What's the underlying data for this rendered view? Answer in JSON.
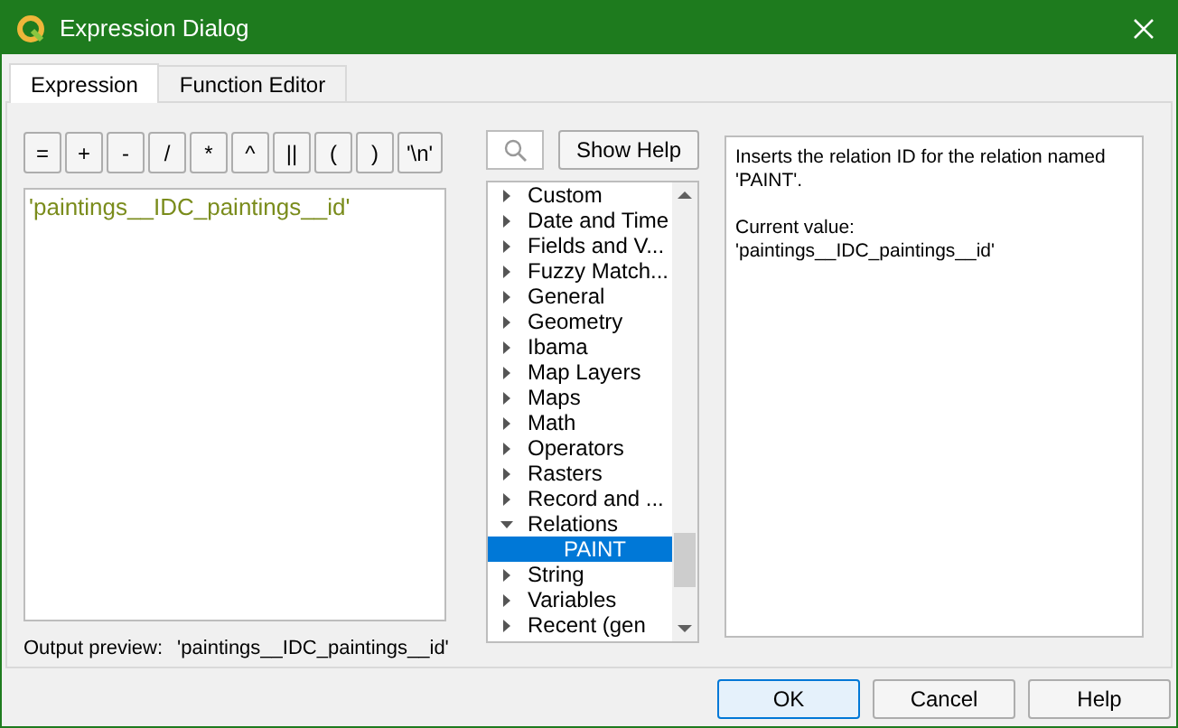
{
  "window": {
    "title": "Expression Dialog"
  },
  "tabs": [
    {
      "label": "Expression",
      "selected": true
    },
    {
      "label": "Function Editor",
      "selected": false
    }
  ],
  "operators": [
    "=",
    "+",
    "-",
    "/",
    "*",
    "^",
    "||",
    "(",
    ")",
    "'\\n'"
  ],
  "expression": {
    "value": "'paintings__IDC_paintings__id'"
  },
  "output_preview": {
    "label": "Output preview:",
    "value": "'paintings__IDC_paintings__id'"
  },
  "show_help_button": "Show Help",
  "function_tree": [
    {
      "label": "Custom",
      "expanded": false,
      "selected": false
    },
    {
      "label": "Date and Time",
      "expanded": false,
      "selected": false
    },
    {
      "label": "Fields and V...",
      "expanded": false,
      "selected": false
    },
    {
      "label": "Fuzzy Match...",
      "expanded": false,
      "selected": false
    },
    {
      "label": "General",
      "expanded": false,
      "selected": false
    },
    {
      "label": "Geometry",
      "expanded": false,
      "selected": false
    },
    {
      "label": "Ibama",
      "expanded": false,
      "selected": false
    },
    {
      "label": "Map Layers",
      "expanded": false,
      "selected": false
    },
    {
      "label": "Maps",
      "expanded": false,
      "selected": false
    },
    {
      "label": "Math",
      "expanded": false,
      "selected": false
    },
    {
      "label": "Operators",
      "expanded": false,
      "selected": false
    },
    {
      "label": "Rasters",
      "expanded": false,
      "selected": false
    },
    {
      "label": "Record and ...",
      "expanded": false,
      "selected": false
    },
    {
      "label": "Relations",
      "expanded": true,
      "selected": false,
      "children": [
        {
          "label": "PAINT",
          "selected": true
        }
      ]
    },
    {
      "label": "String",
      "expanded": false,
      "selected": false
    },
    {
      "label": "Variables",
      "expanded": false,
      "selected": false
    },
    {
      "label": "Recent (gen",
      "expanded": false,
      "selected": false
    }
  ],
  "help": {
    "description": "Inserts the relation ID for the relation named 'PAINT'.",
    "current_value_label": "Current value:",
    "current_value": "'paintings__IDC_paintings__id'"
  },
  "buttons": [
    "OK",
    "Cancel",
    "Help"
  ]
}
